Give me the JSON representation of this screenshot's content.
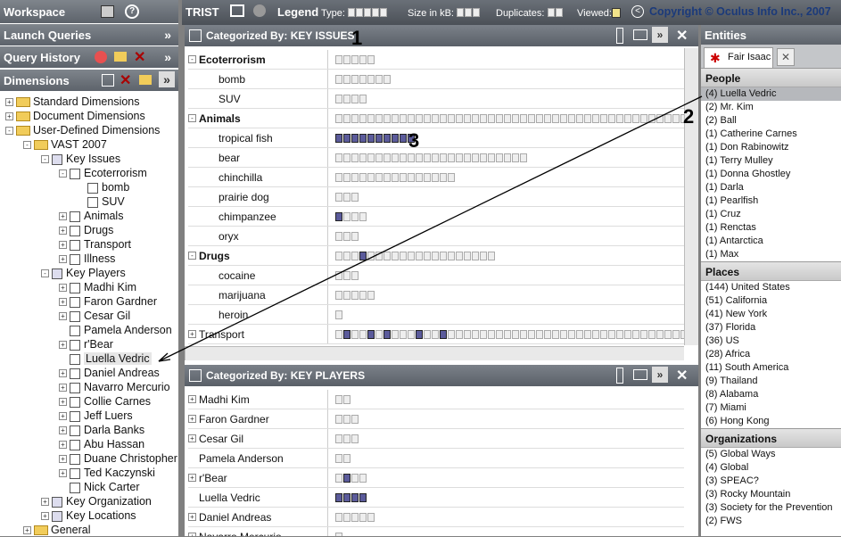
{
  "left": {
    "workspace_label": "Workspace",
    "launch_queries": "Launch Queries",
    "query_history": "Query History",
    "dimensions": "Dimensions",
    "tree": [
      {
        "label": "Standard Dimensions",
        "level": 0,
        "type": "folder",
        "exp": "+"
      },
      {
        "label": "Document Dimensions",
        "level": 0,
        "type": "folder",
        "exp": "+"
      },
      {
        "label": "User-Defined Dimensions",
        "level": 0,
        "type": "folder",
        "exp": "-"
      },
      {
        "label": "VAST 2007",
        "level": 1,
        "type": "folder",
        "exp": "-"
      },
      {
        "label": "Key Issues",
        "level": 2,
        "type": "cat",
        "exp": "-"
      },
      {
        "label": "Ecoterrorism",
        "level": 3,
        "type": "q",
        "exp": "-"
      },
      {
        "label": "bomb",
        "level": 4,
        "type": "q",
        "exp": ""
      },
      {
        "label": "SUV",
        "level": 4,
        "type": "q",
        "exp": ""
      },
      {
        "label": "Animals",
        "level": 3,
        "type": "q",
        "exp": "+"
      },
      {
        "label": "Drugs",
        "level": 3,
        "type": "q",
        "exp": "+"
      },
      {
        "label": "Transport",
        "level": 3,
        "type": "q",
        "exp": "+"
      },
      {
        "label": "Illness",
        "level": 3,
        "type": "q",
        "exp": "+"
      },
      {
        "label": "Key Players",
        "level": 2,
        "type": "cat",
        "exp": "-"
      },
      {
        "label": "Madhi Kim",
        "level": 3,
        "type": "q",
        "exp": "+"
      },
      {
        "label": "Faron Gardner",
        "level": 3,
        "type": "q",
        "exp": "+"
      },
      {
        "label": "Cesar Gil",
        "level": 3,
        "type": "q",
        "exp": "+"
      },
      {
        "label": "Pamela Anderson",
        "level": 3,
        "type": "q",
        "exp": ""
      },
      {
        "label": "r'Bear",
        "level": 3,
        "type": "q",
        "exp": "+"
      },
      {
        "label": "Luella Vedric",
        "level": 3,
        "type": "q",
        "exp": "",
        "sel": true
      },
      {
        "label": "Daniel Andreas",
        "level": 3,
        "type": "q",
        "exp": "+"
      },
      {
        "label": "Navarro Mercurio",
        "level": 3,
        "type": "q",
        "exp": "+"
      },
      {
        "label": "Collie Carnes",
        "level": 3,
        "type": "q",
        "exp": "+"
      },
      {
        "label": "Jeff Luers",
        "level": 3,
        "type": "q",
        "exp": "+"
      },
      {
        "label": "Darla Banks",
        "level": 3,
        "type": "q",
        "exp": "+"
      },
      {
        "label": "Abu Hassan",
        "level": 3,
        "type": "q",
        "exp": "+"
      },
      {
        "label": "Duane Christopher",
        "level": 3,
        "type": "q",
        "exp": "+"
      },
      {
        "label": "Ted Kaczynski",
        "level": 3,
        "type": "q",
        "exp": "+"
      },
      {
        "label": "Nick Carter",
        "level": 3,
        "type": "q",
        "exp": ""
      },
      {
        "label": "Key Organization",
        "level": 2,
        "type": "cat",
        "exp": "+"
      },
      {
        "label": "Key Locations",
        "level": 2,
        "type": "cat",
        "exp": "+"
      },
      {
        "label": "General",
        "level": 1,
        "type": "folder",
        "exp": "+"
      }
    ]
  },
  "topbar": {
    "app": "TRIST",
    "legend": "Legend",
    "type": "Type:",
    "size": "Size in kB:",
    "dups": "Duplicates:",
    "viewed": "Viewed:",
    "copyright": "Copyright © Oculus Info Inc., 2007"
  },
  "grid1": {
    "prefix": "Categorized By:",
    "title": "KEY ISSUES",
    "rows": [
      {
        "label": "Ecoterrorism",
        "bold": true,
        "exp": "-",
        "n": 5,
        "dark": []
      },
      {
        "label": "bomb",
        "indent": true,
        "n": 7,
        "dark": []
      },
      {
        "label": "SUV",
        "indent": true,
        "n": 4,
        "dark": []
      },
      {
        "label": "Animals",
        "bold": true,
        "exp": "-",
        "n": 45,
        "dark": []
      },
      {
        "label": "tropical fish",
        "indent": true,
        "n": 10,
        "dark": [
          0,
          1,
          2,
          3,
          4,
          5,
          6,
          7,
          8,
          9
        ]
      },
      {
        "label": "bear",
        "indent": true,
        "n": 24,
        "dark": []
      },
      {
        "label": "chinchilla",
        "indent": true,
        "n": 15,
        "dark": []
      },
      {
        "label": "prairie dog",
        "indent": true,
        "n": 3,
        "dark": []
      },
      {
        "label": "chimpanzee",
        "indent": true,
        "n": 4,
        "dark": [
          0
        ]
      },
      {
        "label": "oryx",
        "indent": true,
        "n": 3,
        "dark": []
      },
      {
        "label": "Drugs",
        "bold": true,
        "exp": "-",
        "n": 20,
        "dark": [
          3
        ]
      },
      {
        "label": "cocaine",
        "indent": true,
        "n": 3,
        "dark": []
      },
      {
        "label": "marijuana",
        "indent": true,
        "n": 5,
        "dark": []
      },
      {
        "label": "heroin",
        "indent": true,
        "n": 1,
        "dark": []
      },
      {
        "label": "Transport",
        "bold": false,
        "exp": "+",
        "n": 44,
        "dark": [
          1,
          4,
          6,
          10,
          13
        ]
      }
    ]
  },
  "grid2": {
    "prefix": "Categorized By:",
    "title": "KEY PLAYERS",
    "rows": [
      {
        "label": "Madhi Kim",
        "exp": "+",
        "n": 2,
        "dark": []
      },
      {
        "label": "Faron Gardner",
        "exp": "+",
        "n": 3,
        "dark": []
      },
      {
        "label": "Cesar Gil",
        "exp": "+",
        "n": 3,
        "dark": []
      },
      {
        "label": "Pamela Anderson",
        "exp": "",
        "n": 2,
        "dark": []
      },
      {
        "label": "r'Bear",
        "exp": "+",
        "n": 4,
        "dark": [
          1
        ]
      },
      {
        "label": "Luella Vedric",
        "exp": "",
        "n": 4,
        "dark": [
          0,
          1,
          2,
          3
        ]
      },
      {
        "label": "Daniel Andreas",
        "exp": "+",
        "n": 5,
        "dark": []
      },
      {
        "label": "Navarro Mercurio",
        "exp": "+",
        "n": 1,
        "dark": []
      }
    ]
  },
  "right": {
    "title": "Entities",
    "tab": "Fair Isaac",
    "people_h": "People",
    "people": [
      "(4) Luella Vedric",
      "(2) Mr. Kim",
      "(2) Ball",
      "(1) Catherine Carnes",
      "(1) Don Rabinowitz",
      "(1) Terry Mulley",
      "(1) Donna Ghostley",
      "(1) Darla",
      "(1) Pearlfish",
      "(1) Cruz",
      "(1) Renctas",
      "(1) Antarctica",
      "(1) Max"
    ],
    "places_h": "Places",
    "places": [
      "(144) United States",
      "(51) California",
      "(41) New York",
      "(37) Florida",
      "(36) US",
      "(28) Africa",
      "(11) South America",
      "(9) Thailand",
      "(8) Alabama",
      "(7) Miami",
      "(6) Hong Kong"
    ],
    "orgs_h": "Organizations",
    "orgs": [
      "(5) Global Ways",
      "(4) Global",
      "(3) SPEAC?",
      "(3) Rocky Mountain",
      "(3) Society for the Prevention",
      "(2) FWS"
    ]
  },
  "annotations": [
    "1",
    "2",
    "3"
  ]
}
